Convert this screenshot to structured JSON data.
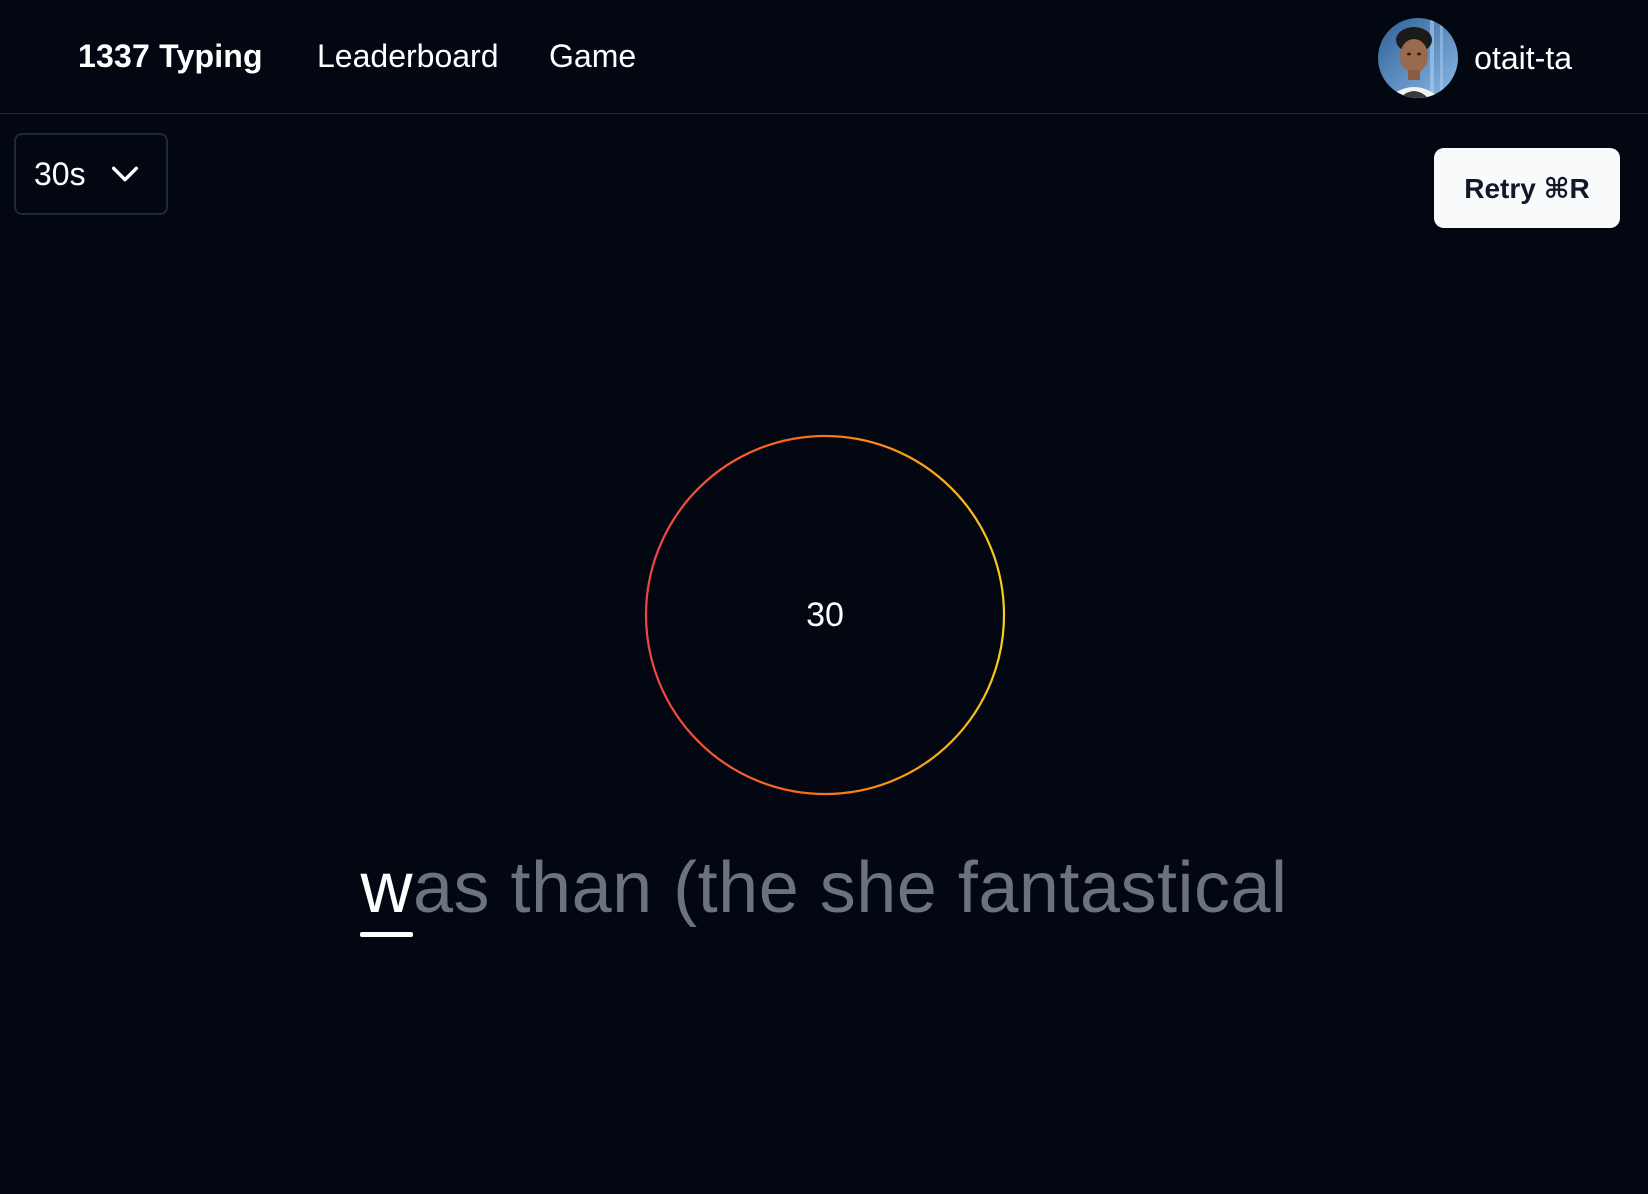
{
  "header": {
    "brand": "1337 Typing",
    "nav": {
      "leaderboard": "Leaderboard",
      "game": "Game"
    },
    "user": {
      "name": "otait-ta",
      "avatar_icon": "user-avatar-photo"
    }
  },
  "controls": {
    "duration_selected": "30s",
    "retry_label": "Retry ⌘R"
  },
  "timer": {
    "value": "30",
    "ring_colors": [
      "#ef4444",
      "#f97316",
      "#facc15"
    ]
  },
  "words": {
    "current_char": "w",
    "remaining_text": "as than (the she fantastical"
  },
  "colors": {
    "background": "#030712",
    "text_active": "#ffffff",
    "text_pending": "#6b7280"
  }
}
